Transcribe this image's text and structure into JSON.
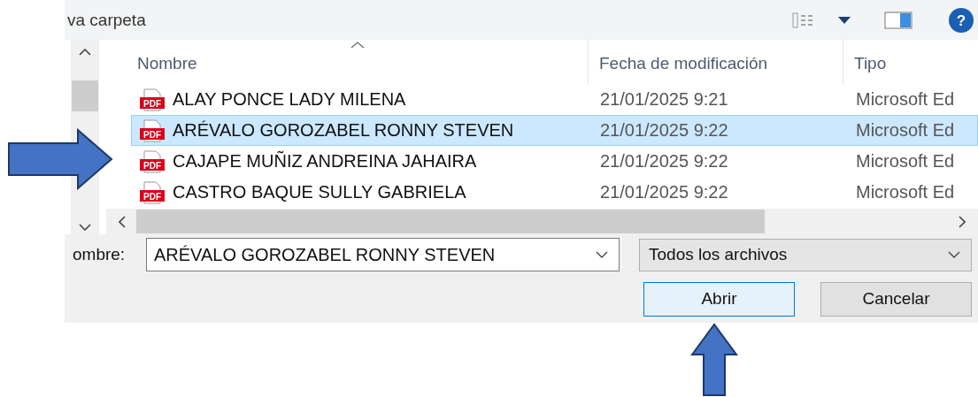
{
  "toolbar": {
    "title": "va carpeta",
    "help": "?"
  },
  "file_list": {
    "columns": [
      "Nombre",
      "Fecha de modificación",
      "Tipo"
    ],
    "rows": [
      {
        "icon_text": "PDF",
        "name": "ALAY PONCE LADY MILENA",
        "date": "21/01/2025 9:21",
        "type": "Microsoft Ed",
        "selected": false
      },
      {
        "icon_text": "PDF",
        "name": "ARÉVALO GOROZABEL RONNY STEVEN",
        "date": "21/01/2025 9:22",
        "type": "Microsoft Ed",
        "selected": true
      },
      {
        "icon_text": "PDF",
        "name": "CAJAPE MUÑIZ ANDREINA JAHAIRA",
        "date": "21/01/2025 9:22",
        "type": "Microsoft Ed",
        "selected": false
      },
      {
        "icon_text": "PDF",
        "name": "CASTRO BAQUE SULLY GABRIELA",
        "date": "21/01/2025 9:22",
        "type": "Microsoft Ed",
        "selected": false
      }
    ]
  },
  "filename": {
    "label": "ombre:",
    "value": "ARÉVALO GOROZABEL RONNY STEVEN"
  },
  "filetype": {
    "value": "Todos los archivos"
  },
  "buttons": [
    {
      "label": "Abrir",
      "default": true
    },
    {
      "label": "Cancelar",
      "default": false
    }
  ]
}
